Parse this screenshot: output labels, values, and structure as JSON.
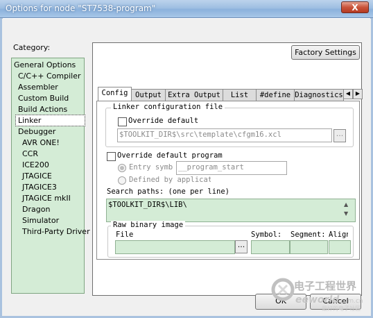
{
  "window": {
    "title": "Options for node \"ST7538-program\"",
    "close_glyph": "X"
  },
  "category": {
    "label": "Category:",
    "items": [
      "General Options",
      "C/C++ Compiler",
      "Assembler",
      "Custom Build",
      "Build Actions",
      "Linker",
      "Debugger",
      "AVR ONE!",
      "CCR",
      "ICE200",
      "JTAGICE",
      "JTAGICE3",
      "JTAGICE mkII",
      "Dragon",
      "Simulator",
      "Third-Party Driver"
    ],
    "selected": "Linker"
  },
  "factory_settings": "Factory Settings",
  "tabs": [
    "Config",
    "Output",
    "Extra Output",
    "List",
    "#define",
    "Diagnostics"
  ],
  "tab_scroll": {
    "left": "◀",
    "right": "▶"
  },
  "linker_config": {
    "group_label": "Linker configuration file",
    "override_label": "Override default",
    "path": "$TOOLKIT_DIR$\\src\\template\\cfgm16.xcl",
    "browse": "..."
  },
  "program": {
    "override_label": "Override default program",
    "entry_label": "Entry symbo",
    "entry_value": "__program_start",
    "defined_label": "Defined by applicat"
  },
  "search": {
    "label": "Search paths:  (one per line)",
    "value": "$TOOLKIT_DIR$\\LIB\\",
    "scroll_up": "▲",
    "scroll_down": "▼"
  },
  "raw_binary": {
    "group_label": "Raw binary image",
    "file_label": "File",
    "symbol_label": "Symbol:",
    "segment_label": "Segment:",
    "align_label": "Align",
    "browse": "..."
  },
  "buttons": {
    "ok": "OK",
    "cancel": "Cancel"
  },
  "watermark": {
    "cn": "电子工程世界",
    "en": "eeworld",
    "dom": ".com.cn",
    "sub": "最好的电子社区"
  }
}
